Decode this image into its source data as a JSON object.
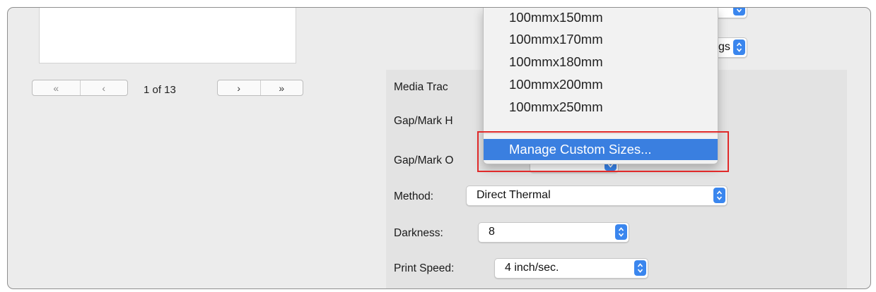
{
  "preview": {
    "page_label": "1 of 13",
    "first_symbol": "«",
    "prev_symbol": "‹",
    "next_symbol": "›",
    "last_symbol": "»"
  },
  "panel": {
    "media_tracking_label": "Media Trac",
    "gap_mark_height_label": "Gap/Mark H",
    "gap_mark_offset_label": "Gap/Mark O",
    "settings_popup_partial": "gs",
    "method": {
      "label": "Method:",
      "value": "Direct Thermal"
    },
    "darkness": {
      "label": "Darkness:",
      "value": "8"
    },
    "print_speed": {
      "label": "Print Speed:",
      "value": "4 inch/sec."
    }
  },
  "paper_size_menu": {
    "items": [
      "100mmx150mm",
      "100mmx170mm",
      "100mmx180mm",
      "100mmx200mm",
      "100mmx250mm"
    ],
    "highlighted_item": "Manage Custom Sizes..."
  },
  "colors": {
    "accent": "#3a7fe0",
    "stepper": "#3a86ee",
    "callout_box": "#e02a2a",
    "window_bg": "#ececec"
  }
}
